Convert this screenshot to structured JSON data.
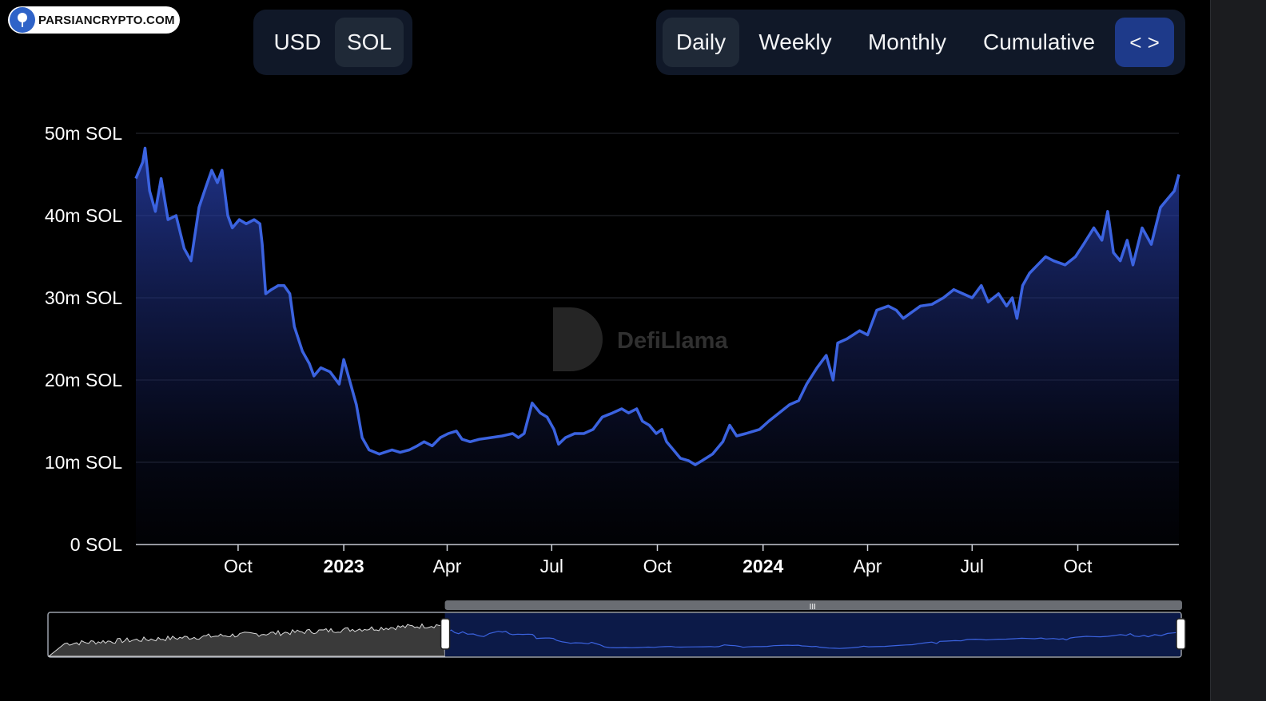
{
  "watermark": {
    "text": "PARSIANCRYPTO.COM"
  },
  "currency_toggle": {
    "items": [
      {
        "label": "USD",
        "active": false
      },
      {
        "label": "SOL",
        "active": true
      }
    ]
  },
  "period_toggle": {
    "items": [
      {
        "label": "Daily",
        "active": true
      },
      {
        "label": "Weekly",
        "active": false
      },
      {
        "label": "Monthly",
        "active": false
      },
      {
        "label": "Cumulative",
        "active": false
      }
    ],
    "embed_icon": "code-brackets-icon"
  },
  "brand": {
    "name": "DefiLlama",
    "logo_icon": "llama-icon"
  },
  "colors": {
    "line": "#3b63e0",
    "fill_top": "#2a44b8",
    "grid": "#2a2d34",
    "axis": "#ffffff",
    "pill_bg": "#101828",
    "pill_active": "#1f2937"
  },
  "chart_data": {
    "type": "area",
    "ylim": [
      0,
      50000000
    ],
    "y_ticks": [
      "0 SOL",
      "10m SOL",
      "20m SOL",
      "30m SOL",
      "40m SOL",
      "50m SOL"
    ],
    "x_ticks": [
      {
        "label": "Oct",
        "date": "2022-10-01",
        "bold": false
      },
      {
        "label": "2023",
        "date": "2023-01-01",
        "bold": true
      },
      {
        "label": "Apr",
        "date": "2023-04-01",
        "bold": false
      },
      {
        "label": "Jul",
        "date": "2023-07-01",
        "bold": false
      },
      {
        "label": "Oct",
        "date": "2023-10-01",
        "bold": false
      },
      {
        "label": "2024",
        "date": "2024-01-01",
        "bold": true
      },
      {
        "label": "Apr",
        "date": "2024-04-01",
        "bold": false
      },
      {
        "label": "Jul",
        "date": "2024-07-01",
        "bold": false
      },
      {
        "label": "Oct",
        "date": "2024-10-01",
        "bold": false
      }
    ],
    "xlim": [
      "2022-07-04",
      "2024-12-28"
    ],
    "grid": true,
    "series": [
      {
        "values": [
          [
            "2022-07-04",
            44500000
          ],
          [
            "2022-07-10",
            46500000
          ],
          [
            "2022-07-12",
            48200000
          ],
          [
            "2022-07-16",
            43000000
          ],
          [
            "2022-07-21",
            40500000
          ],
          [
            "2022-07-26",
            44500000
          ],
          [
            "2022-08-01",
            39500000
          ],
          [
            "2022-08-08",
            40000000
          ],
          [
            "2022-08-15",
            36000000
          ],
          [
            "2022-08-21",
            34500000
          ],
          [
            "2022-08-28",
            41000000
          ],
          [
            "2022-09-03",
            43500000
          ],
          [
            "2022-09-08",
            45500000
          ],
          [
            "2022-09-13",
            44000000
          ],
          [
            "2022-09-17",
            45500000
          ],
          [
            "2022-09-22",
            40000000
          ],
          [
            "2022-09-26",
            38500000
          ],
          [
            "2022-10-02",
            39500000
          ],
          [
            "2022-10-08",
            39000000
          ],
          [
            "2022-10-15",
            39500000
          ],
          [
            "2022-10-20",
            39000000
          ],
          [
            "2022-10-22",
            36500000
          ],
          [
            "2022-10-25",
            30500000
          ],
          [
            "2022-10-30",
            31000000
          ],
          [
            "2022-11-05",
            31500000
          ],
          [
            "2022-11-10",
            31500000
          ],
          [
            "2022-11-15",
            30500000
          ],
          [
            "2022-11-19",
            26500000
          ],
          [
            "2022-11-26",
            23500000
          ],
          [
            "2022-12-02",
            22000000
          ],
          [
            "2022-12-06",
            20500000
          ],
          [
            "2022-12-12",
            21500000
          ],
          [
            "2022-12-20",
            21000000
          ],
          [
            "2022-12-28",
            19500000
          ],
          [
            "2023-01-01",
            22500000
          ],
          [
            "2023-01-06",
            20000000
          ],
          [
            "2023-01-12",
            17000000
          ],
          [
            "2023-01-17",
            13000000
          ],
          [
            "2023-01-23",
            11500000
          ],
          [
            "2023-02-01",
            11000000
          ],
          [
            "2023-02-12",
            11500000
          ],
          [
            "2023-02-19",
            11200000
          ],
          [
            "2023-02-27",
            11500000
          ],
          [
            "2023-03-06",
            12000000
          ],
          [
            "2023-03-12",
            12500000
          ],
          [
            "2023-03-19",
            12000000
          ],
          [
            "2023-03-26",
            13000000
          ],
          [
            "2023-04-02",
            13500000
          ],
          [
            "2023-04-09",
            13800000
          ],
          [
            "2023-04-14",
            12800000
          ],
          [
            "2023-04-21",
            12500000
          ],
          [
            "2023-04-29",
            12800000
          ],
          [
            "2023-05-09",
            13000000
          ],
          [
            "2023-05-19",
            13200000
          ],
          [
            "2023-05-28",
            13500000
          ],
          [
            "2023-06-02",
            13000000
          ],
          [
            "2023-06-07",
            13500000
          ],
          [
            "2023-06-14",
            17200000
          ],
          [
            "2023-06-21",
            16000000
          ],
          [
            "2023-06-27",
            15500000
          ],
          [
            "2023-07-03",
            14000000
          ],
          [
            "2023-07-07",
            12200000
          ],
          [
            "2023-07-13",
            13000000
          ],
          [
            "2023-07-21",
            13500000
          ],
          [
            "2023-07-29",
            13500000
          ],
          [
            "2023-08-06",
            14000000
          ],
          [
            "2023-08-14",
            15500000
          ],
          [
            "2023-08-23",
            16000000
          ],
          [
            "2023-08-31",
            16500000
          ],
          [
            "2023-09-06",
            16000000
          ],
          [
            "2023-09-13",
            16500000
          ],
          [
            "2023-09-18",
            15000000
          ],
          [
            "2023-09-24",
            14500000
          ],
          [
            "2023-09-30",
            13500000
          ],
          [
            "2023-10-05",
            14000000
          ],
          [
            "2023-10-09",
            12500000
          ],
          [
            "2023-10-15",
            11500000
          ],
          [
            "2023-10-21",
            10500000
          ],
          [
            "2023-10-28",
            10200000
          ],
          [
            "2023-11-03",
            9700000
          ],
          [
            "2023-11-09",
            10200000
          ],
          [
            "2023-11-18",
            11000000
          ],
          [
            "2023-11-27",
            12500000
          ],
          [
            "2023-12-03",
            14500000
          ],
          [
            "2023-12-09",
            13200000
          ],
          [
            "2023-12-17",
            13500000
          ],
          [
            "2023-12-29",
            14000000
          ],
          [
            "2024-01-06",
            15000000
          ],
          [
            "2024-01-15",
            16000000
          ],
          [
            "2024-01-24",
            17000000
          ],
          [
            "2024-02-01",
            17500000
          ],
          [
            "2024-02-08",
            19500000
          ],
          [
            "2024-02-17",
            21500000
          ],
          [
            "2024-02-25",
            23000000
          ],
          [
            "2024-03-02",
            20000000
          ],
          [
            "2024-03-06",
            24500000
          ],
          [
            "2024-03-14",
            25000000
          ],
          [
            "2024-03-25",
            26000000
          ],
          [
            "2024-04-01",
            25500000
          ],
          [
            "2024-04-09",
            28500000
          ],
          [
            "2024-04-19",
            29000000
          ],
          [
            "2024-04-26",
            28500000
          ],
          [
            "2024-05-02",
            27500000
          ],
          [
            "2024-05-07",
            28000000
          ],
          [
            "2024-05-17",
            29000000
          ],
          [
            "2024-05-27",
            29200000
          ],
          [
            "2024-06-06",
            30000000
          ],
          [
            "2024-06-15",
            31000000
          ],
          [
            "2024-06-23",
            30500000
          ],
          [
            "2024-07-01",
            30000000
          ],
          [
            "2024-07-09",
            31500000
          ],
          [
            "2024-07-15",
            29500000
          ],
          [
            "2024-07-24",
            30500000
          ],
          [
            "2024-07-31",
            29000000
          ],
          [
            "2024-08-05",
            30000000
          ],
          [
            "2024-08-09",
            27500000
          ],
          [
            "2024-08-14",
            31500000
          ],
          [
            "2024-08-20",
            33000000
          ],
          [
            "2024-08-27",
            34000000
          ],
          [
            "2024-09-03",
            35000000
          ],
          [
            "2024-09-10",
            34500000
          ],
          [
            "2024-09-20",
            34000000
          ],
          [
            "2024-09-29",
            35000000
          ],
          [
            "2024-10-06",
            36500000
          ],
          [
            "2024-10-15",
            38500000
          ],
          [
            "2024-10-22",
            37000000
          ],
          [
            "2024-10-27",
            40500000
          ],
          [
            "2024-11-01",
            35500000
          ],
          [
            "2024-11-07",
            34500000
          ],
          [
            "2024-11-13",
            37000000
          ],
          [
            "2024-11-18",
            34000000
          ],
          [
            "2024-11-26",
            38500000
          ],
          [
            "2024-12-04",
            36500000
          ],
          [
            "2024-12-12",
            41000000
          ],
          [
            "2024-12-18",
            42000000
          ],
          [
            "2024-12-24",
            43000000
          ],
          [
            "2024-12-28",
            45000000
          ]
        ]
      }
    ],
    "range_selector": {
      "start_fraction": 0.35,
      "end_fraction": 1.0
    }
  }
}
